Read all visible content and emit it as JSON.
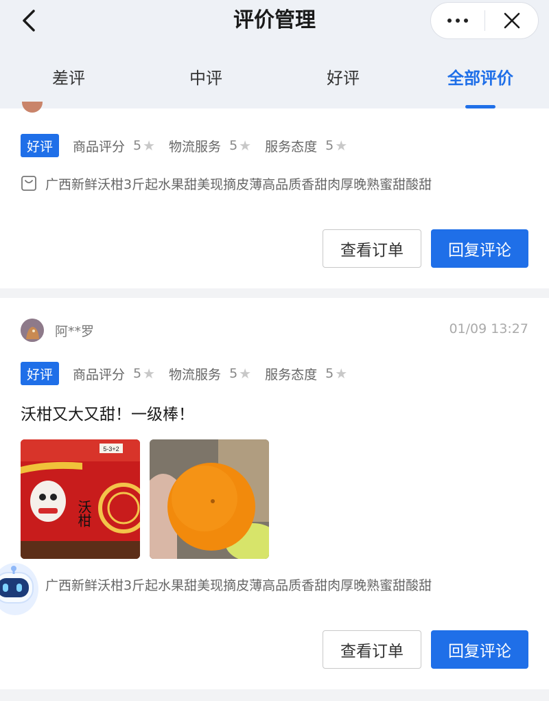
{
  "header": {
    "title": "评价管理",
    "back_icon": "chevron-left-icon",
    "more_icon": "more-dots-icon",
    "close_icon": "close-icon"
  },
  "tabs": [
    {
      "label": "差评",
      "active": false
    },
    {
      "label": "中评",
      "active": false
    },
    {
      "label": "好评",
      "active": false
    },
    {
      "label": "全部评价",
      "active": true
    }
  ],
  "reviews": [
    {
      "badge": "好评",
      "ratings": [
        {
          "label": "商品评分",
          "score": "5"
        },
        {
          "label": "物流服务",
          "score": "5"
        },
        {
          "label": "服务态度",
          "score": "5"
        }
      ],
      "product": "广西新鲜沃柑3斤起水果甜美现摘皮薄高品质香甜肉厚晚熟蜜甜酸甜",
      "view_order_label": "查看订单",
      "reply_label": "回复评论"
    },
    {
      "username": "阿**罗",
      "time": "01/09 13:27",
      "badge": "好评",
      "ratings": [
        {
          "label": "商品评分",
          "score": "5"
        },
        {
          "label": "物流服务",
          "score": "5"
        },
        {
          "label": "服务态度",
          "score": "5"
        }
      ],
      "comment": "沃柑又大又甜！一级棒！",
      "photo_text": "沃柑",
      "photo_label": "5-3+2",
      "product": "广西新鲜沃柑3斤起水果甜美现摘皮薄高品质香甜肉厚晚熟蜜甜酸甜",
      "view_order_label": "查看订单",
      "reply_label": "回复评论"
    }
  ],
  "colors": {
    "accent": "#1f6fe8",
    "header_bg": "#eef1f6",
    "page_bg": "#f2f3f5"
  }
}
